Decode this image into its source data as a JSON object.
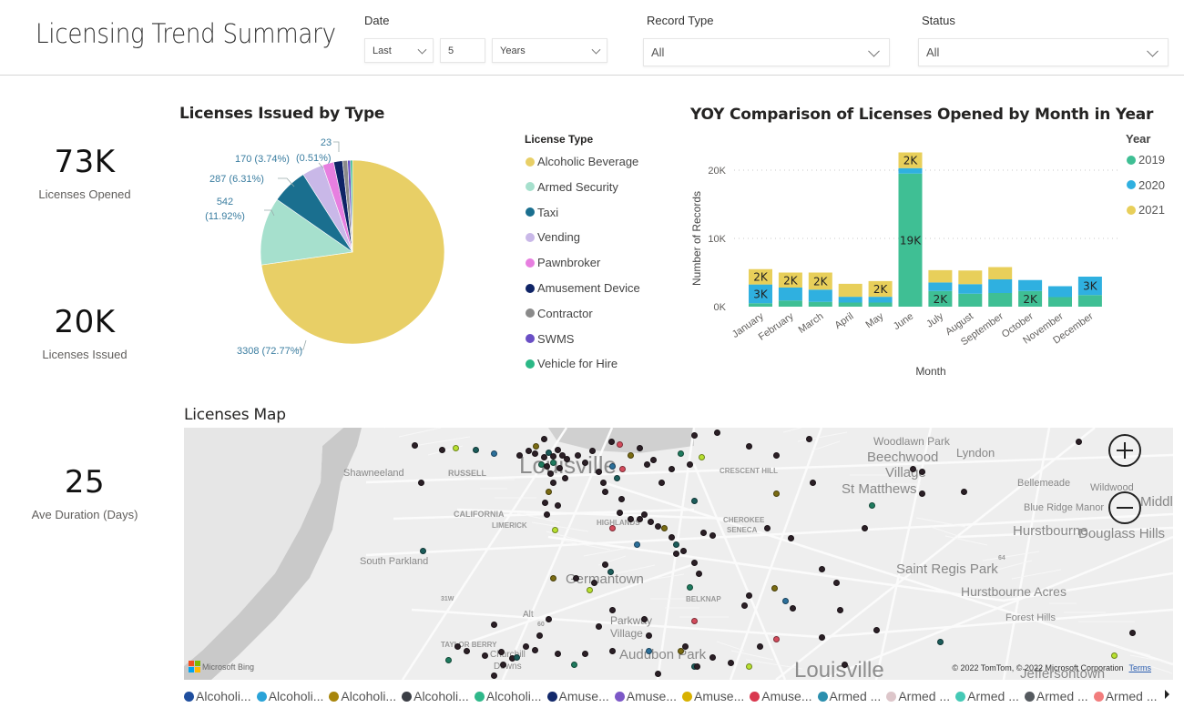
{
  "header": {
    "title": "Licensing Trend Summary",
    "filters": {
      "date": {
        "label": "Date",
        "period": "Last",
        "count": "5",
        "unit": "Years"
      },
      "record_type": {
        "label": "Record Type",
        "value": "All"
      },
      "status": {
        "label": "Status",
        "value": "All"
      }
    }
  },
  "kpis": [
    {
      "value": "73K",
      "label": "Licenses Opened"
    },
    {
      "value": "20K",
      "label": "Licenses Issued"
    },
    {
      "value": "25",
      "label": "Ave Duration (Days)"
    }
  ],
  "pie_section": {
    "title": "Licenses Issued by Type",
    "legend_title": "License Type"
  },
  "bar_section": {
    "title": "YOY Comparison of Licenses Opened by Month in Year",
    "legend_title": "Year"
  },
  "map": {
    "title": "Licenses Map",
    "places": [
      {
        "name": "Woodlawn Park"
      },
      {
        "name": "Lyndon"
      },
      {
        "name": "Beechwood"
      },
      {
        "name": "Village"
      },
      {
        "name": "Shawneeland"
      },
      {
        "name": "RUSSELL"
      },
      {
        "name": "Louisville"
      },
      {
        "name": "CRESCENT HILL"
      },
      {
        "name": "Bellemeade"
      },
      {
        "name": "Wildwood"
      },
      {
        "name": "St Matthews"
      },
      {
        "name": "Blue Ridge Manor"
      },
      {
        "name": "Middletown"
      },
      {
        "name": "CALIFORNIA"
      },
      {
        "name": "LIMERICK"
      },
      {
        "name": "HIGHLANDS"
      },
      {
        "name": "CHEROKEE"
      },
      {
        "name": "SENECA"
      },
      {
        "name": "Hurstbourne"
      },
      {
        "name": "Douglass Hills"
      },
      {
        "name": "South Parkland"
      },
      {
        "name": "Saint Regis Park"
      },
      {
        "name": "Germantown"
      },
      {
        "name": "BELKNAP"
      },
      {
        "name": "Hurstbourne Acres"
      },
      {
        "name": "Parkway"
      },
      {
        "name": "Village"
      },
      {
        "name": "Alt"
      },
      {
        "name": "Forest Hills"
      },
      {
        "name": "TAYLOR BERRY"
      },
      {
        "name": "Churchill"
      },
      {
        "name": "Downs"
      },
      {
        "name": "Audubon Park"
      },
      {
        "name": "Louisville"
      },
      {
        "name": "Jeffersontown"
      },
      {
        "name": "31W"
      },
      {
        "name": "60"
      },
      {
        "name": "64"
      }
    ],
    "bing_label": "Microsoft Bing",
    "attribution": "© 2022 TomTom, © 2022 Microsoft Corporation",
    "terms_label": "Terms",
    "zoom_in_label": "+",
    "zoom_out_label": "−",
    "legend": [
      {
        "label": "Alcoholi...",
        "color": "#1f4e9e"
      },
      {
        "label": "Alcoholi...",
        "color": "#2aa3d8"
      },
      {
        "label": "Alcoholi...",
        "color": "#a8860c"
      },
      {
        "label": "Alcoholi...",
        "color": "#3b3e45"
      },
      {
        "label": "Alcoholi...",
        "color": "#2fb88a"
      },
      {
        "label": "Amuse...",
        "color": "#13296b"
      },
      {
        "label": "Amuse...",
        "color": "#7c58c7"
      },
      {
        "label": "Amuse...",
        "color": "#d8b100"
      },
      {
        "label": "Amuse...",
        "color": "#d9384f"
      },
      {
        "label": "Armed ...",
        "color": "#2b8fae"
      },
      {
        "label": "Armed ...",
        "color": "#ddc6ca"
      },
      {
        "label": "Armed ...",
        "color": "#45c9b6"
      },
      {
        "label": "Armed ...",
        "color": "#555a5f"
      },
      {
        "label": "Armed ...",
        "color": "#f27d7d"
      }
    ]
  },
  "chart_data": [
    {
      "type": "pie",
      "title": "Licenses Issued by Type",
      "legend_title": "License Type",
      "legend_position": "right",
      "categories": [
        "Alcoholic Beverage",
        "Armed Security",
        "Taxi",
        "Vending",
        "Pawnbroker",
        "Amusement Device",
        "Contractor",
        "SWMS",
        "Vehicle for Hire"
      ],
      "values": [
        3308,
        542,
        287,
        170,
        90,
        70,
        40,
        23,
        16
      ],
      "colors": [
        "#e8cf66",
        "#a6e0cd",
        "#1a6f8f",
        "#c9b8e8",
        "#e77fe0",
        "#0f2466",
        "#8a8a8a",
        "#6a4fc5",
        "#2bb886"
      ],
      "data_labels": [
        {
          "category": "Alcoholic Beverage",
          "text": "3308 (72.77%)"
        },
        {
          "category": "Armed Security",
          "text": "542 (11.92%)"
        },
        {
          "category": "Taxi",
          "text": "287 (6.31%)"
        },
        {
          "category": "Vending",
          "text": "170 (3.74%)"
        },
        {
          "category": "SWMS",
          "text": "23 (0.51%)"
        }
      ]
    },
    {
      "type": "bar",
      "stacked": true,
      "title": "YOY Comparison of Licenses Opened by Month in Year",
      "xlabel": "Month",
      "ylabel": "Number of Records",
      "ylim": [
        0,
        22500
      ],
      "yticks": [
        0,
        10000,
        20000
      ],
      "ytick_labels": [
        "0K",
        "10K",
        "20K"
      ],
      "grid": true,
      "legend_position": "right",
      "categories": [
        "January",
        "February",
        "March",
        "April",
        "May",
        "June",
        "July",
        "August",
        "September",
        "October",
        "November",
        "December"
      ],
      "series": [
        {
          "name": "2019",
          "color": "#3fbf94",
          "values": [
            500,
            900,
            700,
            600,
            600,
            19500,
            2300,
            1900,
            2000,
            2300,
            1400,
            1700
          ]
        },
        {
          "name": "2020",
          "color": "#2fb0e0",
          "values": [
            2750,
            1900,
            1800,
            850,
            850,
            800,
            1250,
            1400,
            2000,
            1600,
            1600,
            2700
          ]
        },
        {
          "name": "2021",
          "color": "#e8cf5a",
          "values": [
            2250,
            2200,
            2500,
            1900,
            2300,
            2300,
            1800,
            2000,
            1800,
            0,
            0,
            0
          ]
        }
      ],
      "data_labels": [
        {
          "month": "January",
          "series": "2021",
          "text": "2K"
        },
        {
          "month": "January",
          "series": "2020",
          "text": "3K"
        },
        {
          "month": "February",
          "series": "2021",
          "text": "2K"
        },
        {
          "month": "March",
          "series": "2021",
          "text": "2K"
        },
        {
          "month": "May",
          "series": "2021",
          "text": "2K"
        },
        {
          "month": "June",
          "series": "2021",
          "text": "2K"
        },
        {
          "month": "June",
          "series": "2019",
          "text": "19K"
        },
        {
          "month": "July",
          "series": "2019",
          "text": "2K"
        },
        {
          "month": "October",
          "series": "2019",
          "text": "2K"
        },
        {
          "month": "December",
          "series": "2020",
          "text": "3K"
        }
      ]
    }
  ]
}
